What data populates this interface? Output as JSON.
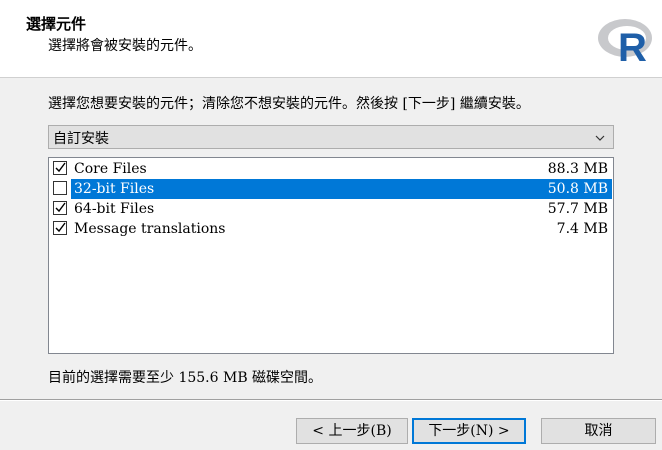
{
  "header": {
    "title": "選擇元件",
    "subtitle": "選擇將會被安裝的元件。"
  },
  "logo": {
    "icon": "r-logo-icon",
    "letter": "R",
    "accent": "#1f5fa8"
  },
  "instruction": "選擇您想要安裝的元件；清除您不想安裝的元件。然後按 [下一步] 繼續安裝。",
  "install_type": {
    "selected": "自訂安裝",
    "icon": "chevron-down-icon"
  },
  "components": [
    {
      "label": "Core Files",
      "size": "88.3 MB",
      "checked": true,
      "selected": false
    },
    {
      "label": "32-bit Files",
      "size": "50.8 MB",
      "checked": false,
      "selected": true
    },
    {
      "label": "64-bit Files",
      "size": "57.7 MB",
      "checked": true,
      "selected": false
    },
    {
      "label": "Message translations",
      "size": "7.4 MB",
      "checked": true,
      "selected": false
    }
  ],
  "space_required": "目前的選擇需要至少 155.6 MB 磁碟空間。",
  "buttons": {
    "back": "< 上一步(B)",
    "next": "下一步(N) >",
    "cancel": "取消"
  },
  "colors": {
    "selection": "#0078d7",
    "background": "#f0f0f0"
  }
}
